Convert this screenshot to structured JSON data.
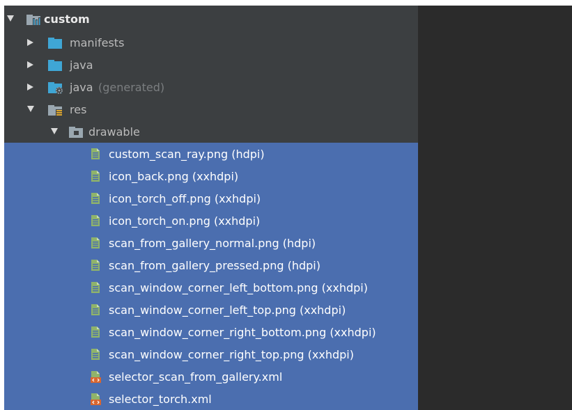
{
  "project": {
    "module": {
      "label": "custom",
      "icon": "module-folder-icon"
    },
    "items": [
      {
        "label": "manifests",
        "icon": "folder-icon"
      },
      {
        "label": "java",
        "icon": "source-folder-icon"
      },
      {
        "label": "java",
        "suffix": "(generated)",
        "icon": "generated-source-folder-icon"
      },
      {
        "label": "res",
        "icon": "resources-folder-icon"
      },
      {
        "label": "drawable",
        "icon": "drawable-folder-icon"
      }
    ],
    "files": [
      {
        "label": "custom_scan_ray.png (hdpi)",
        "icon": "image-file-icon"
      },
      {
        "label": "icon_back.png (xxhdpi)",
        "icon": "image-file-icon"
      },
      {
        "label": "icon_torch_off.png (xxhdpi)",
        "icon": "image-file-icon"
      },
      {
        "label": "icon_torch_on.png (xxhdpi)",
        "icon": "image-file-icon"
      },
      {
        "label": "scan_from_gallery_normal.png (hdpi)",
        "icon": "image-file-icon"
      },
      {
        "label": "scan_from_gallery_pressed.png (hdpi)",
        "icon": "image-file-icon"
      },
      {
        "label": "scan_window_corner_left_bottom.png (xxhdpi)",
        "icon": "image-file-icon"
      },
      {
        "label": "scan_window_corner_left_top.png (xxhdpi)",
        "icon": "image-file-icon"
      },
      {
        "label": "scan_window_corner_right_bottom.png (xxhdpi)",
        "icon": "image-file-icon"
      },
      {
        "label": "scan_window_corner_right_top.png (xxhdpi)",
        "icon": "image-file-icon"
      },
      {
        "label": "selector_scan_from_gallery.xml",
        "icon": "xml-file-icon"
      },
      {
        "label": "selector_torch.xml",
        "icon": "xml-file-icon"
      }
    ]
  },
  "colors": {
    "tree_background": "#3c3f41",
    "editor_background": "#2b2b2b",
    "selection": "#4b6eaf",
    "folder_blue": "#3fa6d5",
    "text": "#bbbbbb",
    "muted_text": "#7b7e80"
  }
}
